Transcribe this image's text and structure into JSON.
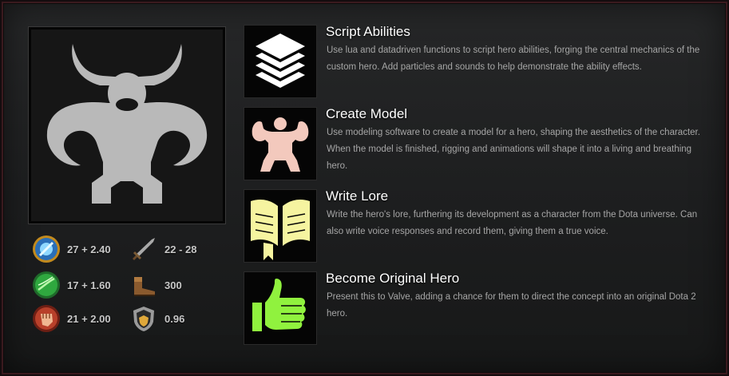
{
  "stats": [
    {
      "id": "intelligence",
      "icon": "intelligence-icon",
      "value": "27 + 2.40"
    },
    {
      "id": "damage",
      "icon": "sword-icon",
      "value": "22 - 28"
    },
    {
      "id": "agility",
      "icon": "agility-icon",
      "value": "17 + 1.60"
    },
    {
      "id": "movespeed",
      "icon": "boots-icon",
      "value": "300"
    },
    {
      "id": "strength",
      "icon": "fist-icon",
      "value": "21 + 2.00"
    },
    {
      "id": "armor",
      "icon": "shield-icon",
      "value": "0.96"
    }
  ],
  "steps": [
    {
      "icon": "stacked-layers-icon",
      "title": "Script Abilities",
      "description": "Use lua and datadriven functions to script hero abilities, forging the central mechanics of the custom hero. Add particles and sounds to help demonstrate the ability effects.",
      "color": "#ffffff"
    },
    {
      "icon": "bodybuilder-icon",
      "title": "Create Model",
      "description": "Use modeling software to create a model for a hero, shaping the aesthetics of the character. When the model is finished, rigging and animations will shape it into a living and breathing hero.",
      "color": "#f3c9bd"
    },
    {
      "icon": "open-book-icon",
      "title": "Write Lore",
      "description": "Write the hero's lore, furthering its development as a character from the Dota universe. Can also write voice responses and record them, giving them a true voice.",
      "color": "#f6f4a0"
    },
    {
      "icon": "thumbs-up-icon",
      "title": "Become Original Hero",
      "description": "Present this to Valve, adding a chance for them to direct the concept into an original Dota 2 hero.",
      "color": "#90f23e"
    }
  ]
}
